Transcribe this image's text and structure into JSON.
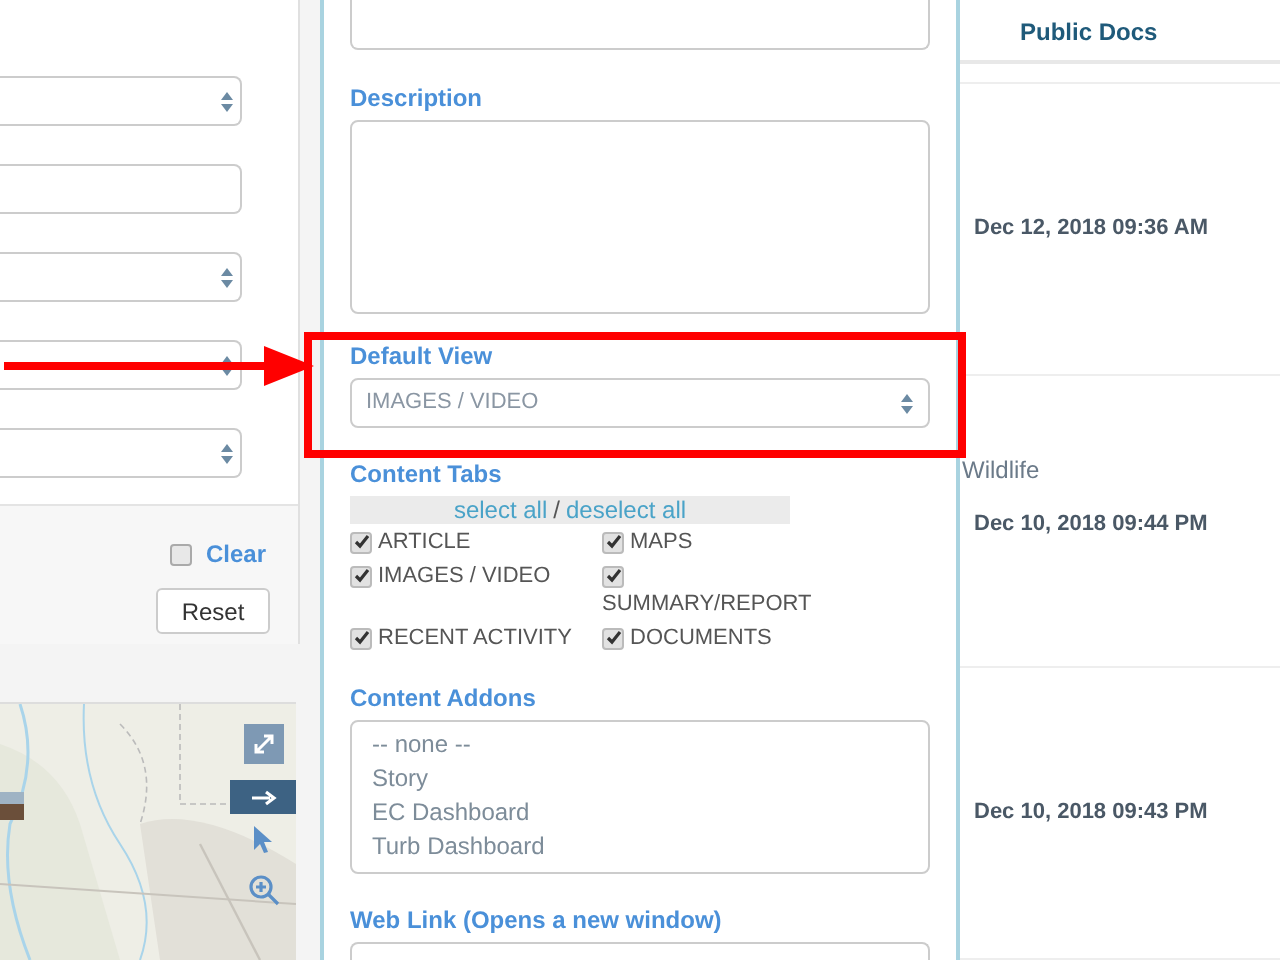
{
  "filter_panel": {
    "clear": {
      "label": "Clear",
      "checked": false
    },
    "reset_button": "Reset"
  },
  "editor": {
    "description_label": "Description",
    "default_view": {
      "label": "Default View",
      "value": "IMAGES / VIDEO"
    },
    "content_tabs": {
      "label": "Content Tabs",
      "select_all": "select all",
      "separator": "/",
      "deselect_all": "deselect all",
      "items": [
        {
          "label": "ARTICLE",
          "checked": true
        },
        {
          "label": "MAPS",
          "checked": true
        },
        {
          "label": "IMAGES / VIDEO",
          "checked": true
        },
        {
          "label": "SUMMARY/REPORT",
          "checked": true
        },
        {
          "label": "RECENT ACTIVITY",
          "checked": true
        },
        {
          "label": "DOCUMENTS",
          "checked": true
        }
      ]
    },
    "content_addons": {
      "label": "Content Addons",
      "options": [
        "-- none --",
        "Story",
        "EC Dashboard",
        "Turb Dashboard"
      ]
    },
    "web_link_label": "Web Link (Opens a new window)"
  },
  "table": {
    "column": "Public Docs",
    "rows": [
      {
        "dates": [
          "Dec 12, 2018 09:36 AM"
        ]
      },
      {
        "note": "Wildlife",
        "dates": [
          "Dec 10, 2018 09:44 PM"
        ]
      },
      {
        "dates": [
          "Dec 10, 2018 09:43 PM"
        ]
      }
    ]
  }
}
